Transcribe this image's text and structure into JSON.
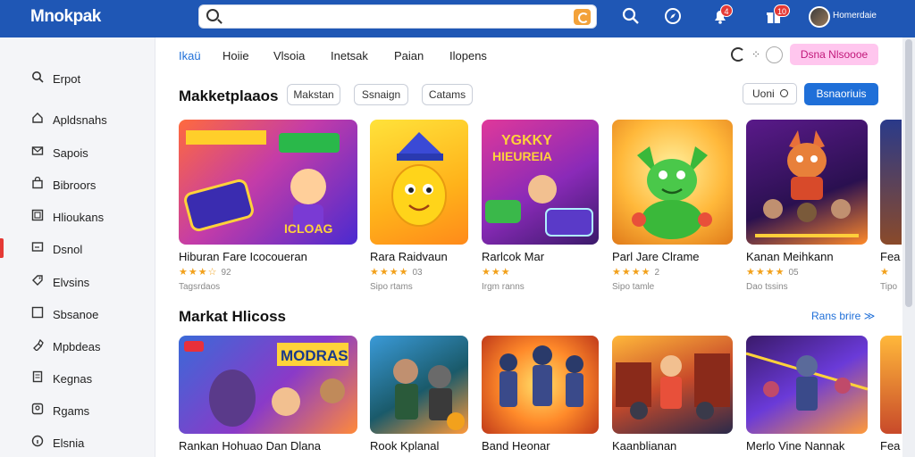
{
  "app": {
    "logo": "Mnokpak"
  },
  "search": {
    "value": "",
    "placeholder": ""
  },
  "topbar": {
    "icons": [
      "search-icon",
      "compass-icon",
      "bell-icon",
      "gift-icon"
    ],
    "bell_badge": "4",
    "gift_badge": "10",
    "username": "Homerdaie"
  },
  "sidebar": {
    "items": [
      {
        "label": "Erpot",
        "icon": "search-icon"
      },
      {
        "label": "Apldsnahs",
        "icon": "home-icon"
      },
      {
        "label": "Sapois",
        "icon": "mail-icon"
      },
      {
        "label": "Bibroors",
        "icon": "bag-icon"
      },
      {
        "label": "Hlioukans",
        "icon": "grid-icon"
      },
      {
        "label": "Dsnol",
        "icon": "tv-icon"
      },
      {
        "label": "Elvsins",
        "icon": "tag-icon"
      },
      {
        "label": "Sbsanoe",
        "icon": "square-icon"
      },
      {
        "label": "Mpbdeas",
        "icon": "paint-icon"
      },
      {
        "label": "Kegnas",
        "icon": "doc-icon"
      },
      {
        "label": "Rgams",
        "icon": "people-icon"
      },
      {
        "label": "Elsnia",
        "icon": "info-icon"
      }
    ],
    "active_index": 5
  },
  "tabs": [
    "Ikaü",
    "Hoiie",
    "Vlsoia",
    "Inetsak",
    "Paian",
    "Ilopens"
  ],
  "active_tab": 0,
  "toolbar": {
    "dots": "⁘",
    "pink_button": "Dsna  Nlsoooe"
  },
  "section1": {
    "title": "Makketplaaos",
    "chips": [
      "Makstan",
      "Ssnaign",
      "Catams"
    ],
    "sort_label": "Uoni",
    "blue_button": "Bsnaoriuis"
  },
  "cards_row1": [
    {
      "title": "Hiburan Fare Icocoueran",
      "stars": "★★★☆",
      "rating": "92",
      "sub": "Tagsrdaos"
    },
    {
      "title": "Rara Raidvaun",
      "stars": "★★★★",
      "rating": "03",
      "sub": "Sipo rtams"
    },
    {
      "title": "Rarlcok Mar",
      "stars": "★★★",
      "rating": "",
      "sub": "Irgm ranns"
    },
    {
      "title": "Parl Jare Clrame",
      "stars": "★★★★",
      "rating": "2",
      "sub": "Sipo tamle"
    },
    {
      "title": "Kanan Meihkann",
      "stars": "★★★★",
      "rating": "05",
      "sub": "Dao tssins"
    },
    {
      "title": "Fea",
      "stars": "★",
      "rating": "",
      "sub": "Tipo"
    }
  ],
  "section2": {
    "title": "Markat Hlicoss",
    "see_more": "Rans brire ≫"
  },
  "cards_row2": [
    {
      "title": "Rankan Hohuao Dan Dlana"
    },
    {
      "title": "Rook Kplanal"
    },
    {
      "title": "Band Heonar"
    },
    {
      "title": "Kaanblianan"
    },
    {
      "title": "Merlo Vine Nannak"
    },
    {
      "title": "Fea"
    }
  ],
  "colors": {
    "topbar": "#1f57b5",
    "accent": "#1f6fd8",
    "pink": "#ffc6ee",
    "star": "#f2a11c",
    "active": "#e53935"
  }
}
